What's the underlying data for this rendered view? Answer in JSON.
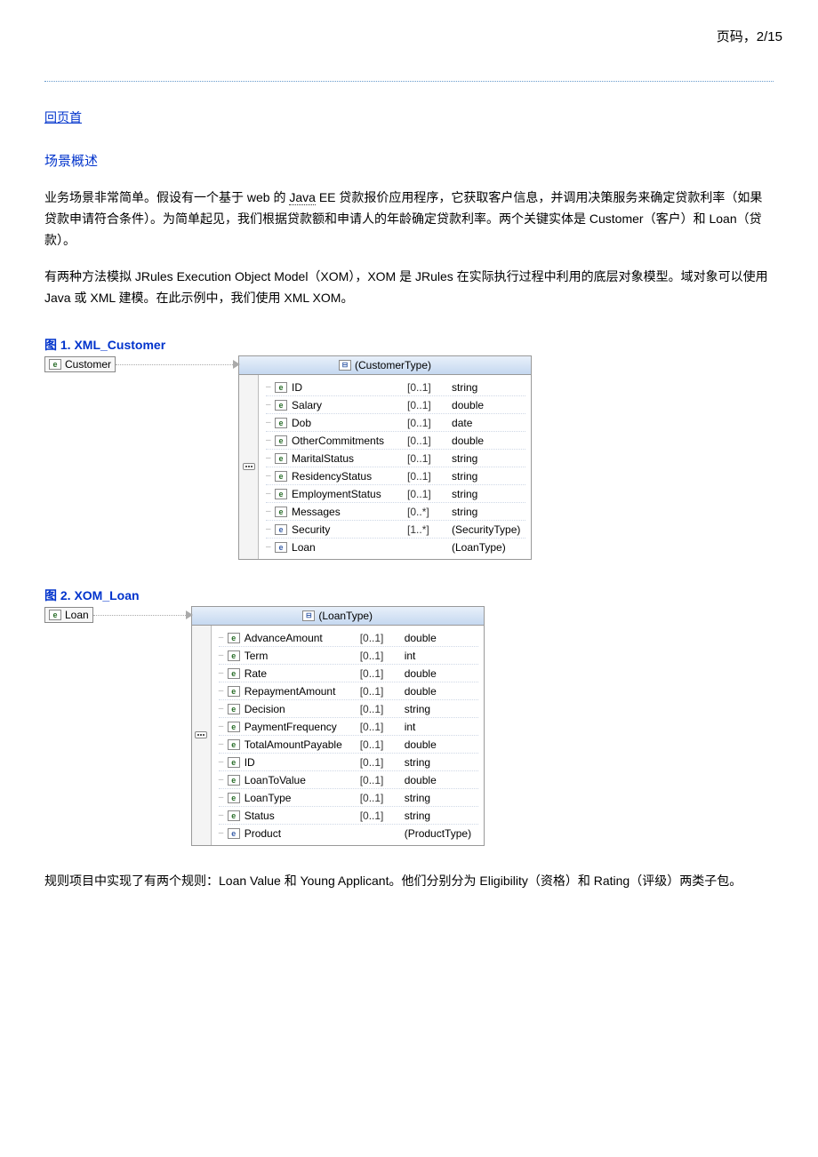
{
  "header": {
    "page_label": "页码，2/15"
  },
  "links": {
    "back_to_top": "回页首"
  },
  "section": {
    "title": "场景概述"
  },
  "paragraphs": {
    "p1a": "业务场景非常简单。假设有一个基于 web 的 ",
    "java_u": "Java",
    "p1b": " EE 贷款报价应用程序，它获取客户信息，并调用决策服务来确定贷款利率（如果贷款申请符合条件）。为简单起见，我们根据贷款额和申请人的年龄确定贷款利率。两个关键实体是 Customer（客户）和 Loan（贷款）。",
    "p2": "有两种方法模拟 JRules Execution Object Model（XOM），XOM 是 JRules 在实际执行过程中利用的底层对象模型。域对象可以使用 Java 或 XML 建模。在此示例中，我们使用 XML XOM。",
    "p3": "规则项目中实现了有两个规则：Loan Value 和 Young Applicant。他们分别分为 Eligibility（资格）和 Rating（评级）两类子包。"
  },
  "figure1": {
    "caption": "图 1. XML_Customer",
    "root": "Customer",
    "type_name": "(CustomerType)",
    "rows": [
      {
        "icon": "e",
        "name": "ID",
        "card": "[0..1]",
        "type": "string"
      },
      {
        "icon": "e",
        "name": "Salary",
        "card": "[0..1]",
        "type": "double"
      },
      {
        "icon": "e",
        "name": "Dob",
        "card": "[0..1]",
        "type": "date"
      },
      {
        "icon": "e",
        "name": "OtherCommitments",
        "card": "[0..1]",
        "type": "double"
      },
      {
        "icon": "e",
        "name": "MaritalStatus",
        "card": "[0..1]",
        "type": "string"
      },
      {
        "icon": "e",
        "name": "ResidencyStatus",
        "card": "[0..1]",
        "type": "string"
      },
      {
        "icon": "e",
        "name": "EmploymentStatus",
        "card": "[0..1]",
        "type": "string"
      },
      {
        "icon": "e",
        "name": "Messages",
        "card": "[0..*]",
        "type": "string"
      },
      {
        "icon": "ref",
        "name": "Security",
        "card": "[1..*]",
        "type": "(SecurityType)"
      },
      {
        "icon": "ref",
        "name": "Loan",
        "card": "",
        "type": "(LoanType)"
      }
    ]
  },
  "figure2": {
    "caption": "图 2. XOM_Loan",
    "root": "Loan",
    "type_name": "(LoanType)",
    "rows": [
      {
        "icon": "e",
        "name": "AdvanceAmount",
        "card": "[0..1]",
        "type": "double"
      },
      {
        "icon": "e",
        "name": "Term",
        "card": "[0..1]",
        "type": "int"
      },
      {
        "icon": "e",
        "name": "Rate",
        "card": "[0..1]",
        "type": "double"
      },
      {
        "icon": "e",
        "name": "RepaymentAmount",
        "card": "[0..1]",
        "type": "double"
      },
      {
        "icon": "e",
        "name": "Decision",
        "card": "[0..1]",
        "type": "string"
      },
      {
        "icon": "e",
        "name": "PaymentFrequency",
        "card": "[0..1]",
        "type": "int"
      },
      {
        "icon": "e",
        "name": "TotalAmountPayable",
        "card": "[0..1]",
        "type": "double"
      },
      {
        "icon": "e",
        "name": "ID",
        "card": "[0..1]",
        "type": "string"
      },
      {
        "icon": "e",
        "name": "LoanToValue",
        "card": "[0..1]",
        "type": "double"
      },
      {
        "icon": "e",
        "name": "LoanType",
        "card": "[0..1]",
        "type": "string"
      },
      {
        "icon": "e",
        "name": "Status",
        "card": "[0..1]",
        "type": "string"
      },
      {
        "icon": "ref",
        "name": "Product",
        "card": "",
        "type": "(ProductType)"
      }
    ]
  },
  "icon_glyphs": {
    "e": "e",
    "ref": "e",
    "type": "⊟"
  }
}
